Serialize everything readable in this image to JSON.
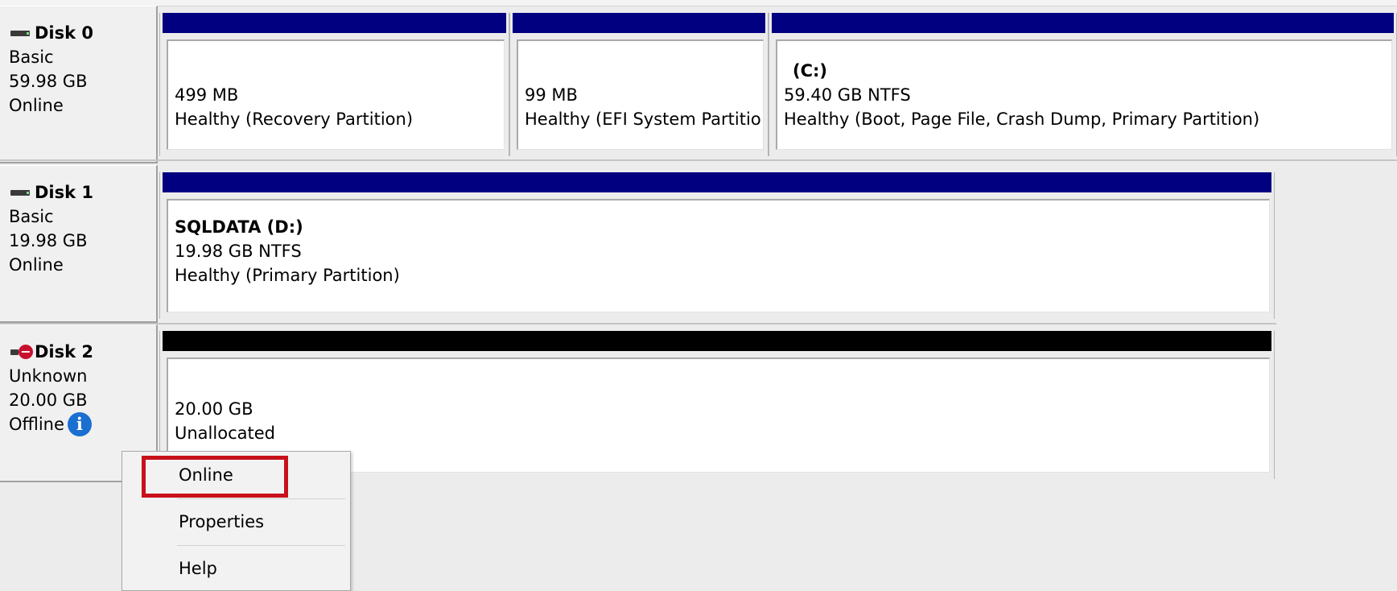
{
  "disks": [
    {
      "name": "Disk 0",
      "type": "Basic",
      "size": "59.98 GB",
      "status": "Online",
      "partitions": [
        {
          "name": "",
          "size": "499 MB",
          "status": "Healthy (Recovery Partition)"
        },
        {
          "name": "",
          "size": "99 MB",
          "status": "Healthy (EFI System Partitio"
        },
        {
          "name": "(C:)",
          "size": "59.40 GB NTFS",
          "status": "Healthy (Boot, Page File, Crash Dump, Primary Partition)"
        }
      ]
    },
    {
      "name": "Disk 1",
      "type": "Basic",
      "size": "19.98 GB",
      "status": "Online",
      "partitions": [
        {
          "name": "SQLDATA  (D:)",
          "size": "19.98 GB NTFS",
          "status": "Healthy (Primary Partition)"
        }
      ]
    },
    {
      "name": "Disk 2",
      "type": "Unknown",
      "size": "20.00 GB",
      "status": "Offline",
      "partitions": [
        {
          "name": "",
          "size": "20.00 GB",
          "status": "Unallocated"
        }
      ]
    }
  ],
  "context_menu": {
    "items": [
      {
        "label": "Online",
        "highlighted": true
      },
      {
        "label": "Properties"
      },
      {
        "label": "Help"
      }
    ]
  },
  "colors": {
    "partition_header": "#000080",
    "unallocated_header": "#000000",
    "highlight": "#c8101a",
    "info_icon": "#1a6fd1",
    "error_icon": "#c8102e"
  },
  "icons": {
    "disk": "disk-icon",
    "offline_disk": "disk-offline-icon",
    "info": "info-icon"
  }
}
